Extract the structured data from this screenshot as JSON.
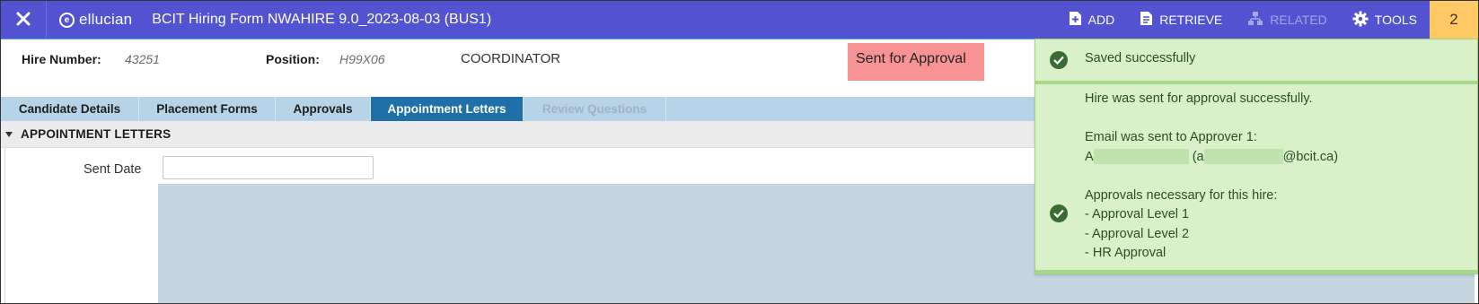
{
  "app": {
    "brand": "ellucian",
    "title": "BCIT Hiring Form NWAHIRE 9.0_2023-08-03 (BUS1)"
  },
  "toolbar": {
    "add_label": "ADD",
    "retrieve_label": "RETRIEVE",
    "related_label": "RELATED",
    "tools_label": "TOOLS",
    "notification_count": "2"
  },
  "header": {
    "hire_number_label": "Hire Number:",
    "hire_number_value": "43251",
    "position_label": "Position:",
    "position_value": "H99X06",
    "position_desc": "COORDINATOR",
    "status": "Sent for Approval"
  },
  "tabs": [
    {
      "label": "Candidate Details",
      "state": "normal"
    },
    {
      "label": "Placement Forms",
      "state": "normal"
    },
    {
      "label": "Approvals",
      "state": "normal"
    },
    {
      "label": "Appointment Letters",
      "state": "active"
    },
    {
      "label": "Review Questions",
      "state": "disabled"
    }
  ],
  "section": {
    "title": "APPOINTMENT LETTERS"
  },
  "form": {
    "sent_date_label": "Sent Date",
    "sent_date_value": ""
  },
  "notifications": {
    "saved": "Saved successfully",
    "lines": [
      "Hire was sent for approval successfully.",
      "",
      "Email was sent to Approver 1:",
      "",
      "",
      "Approvals necessary for this hire:",
      "- Approval Level 1",
      "- Approval Level 2",
      "- HR Approval"
    ],
    "approver_prefix": "A",
    "approver_paren_open": "(a",
    "approver_email_suffix": "@bcit.ca)"
  },
  "colors": {
    "topbar": "#5353d1",
    "active_tab": "#1f6fa8",
    "status_badge": "#f89393",
    "notification_bg": "#d9f0c9",
    "notification_badge": "#ffc966"
  },
  "icons": [
    "close-icon",
    "ellucian-logo-icon",
    "add-icon",
    "retrieve-icon",
    "related-icon",
    "gear-icon",
    "check-circle-icon",
    "collapse-triangle-icon"
  ]
}
